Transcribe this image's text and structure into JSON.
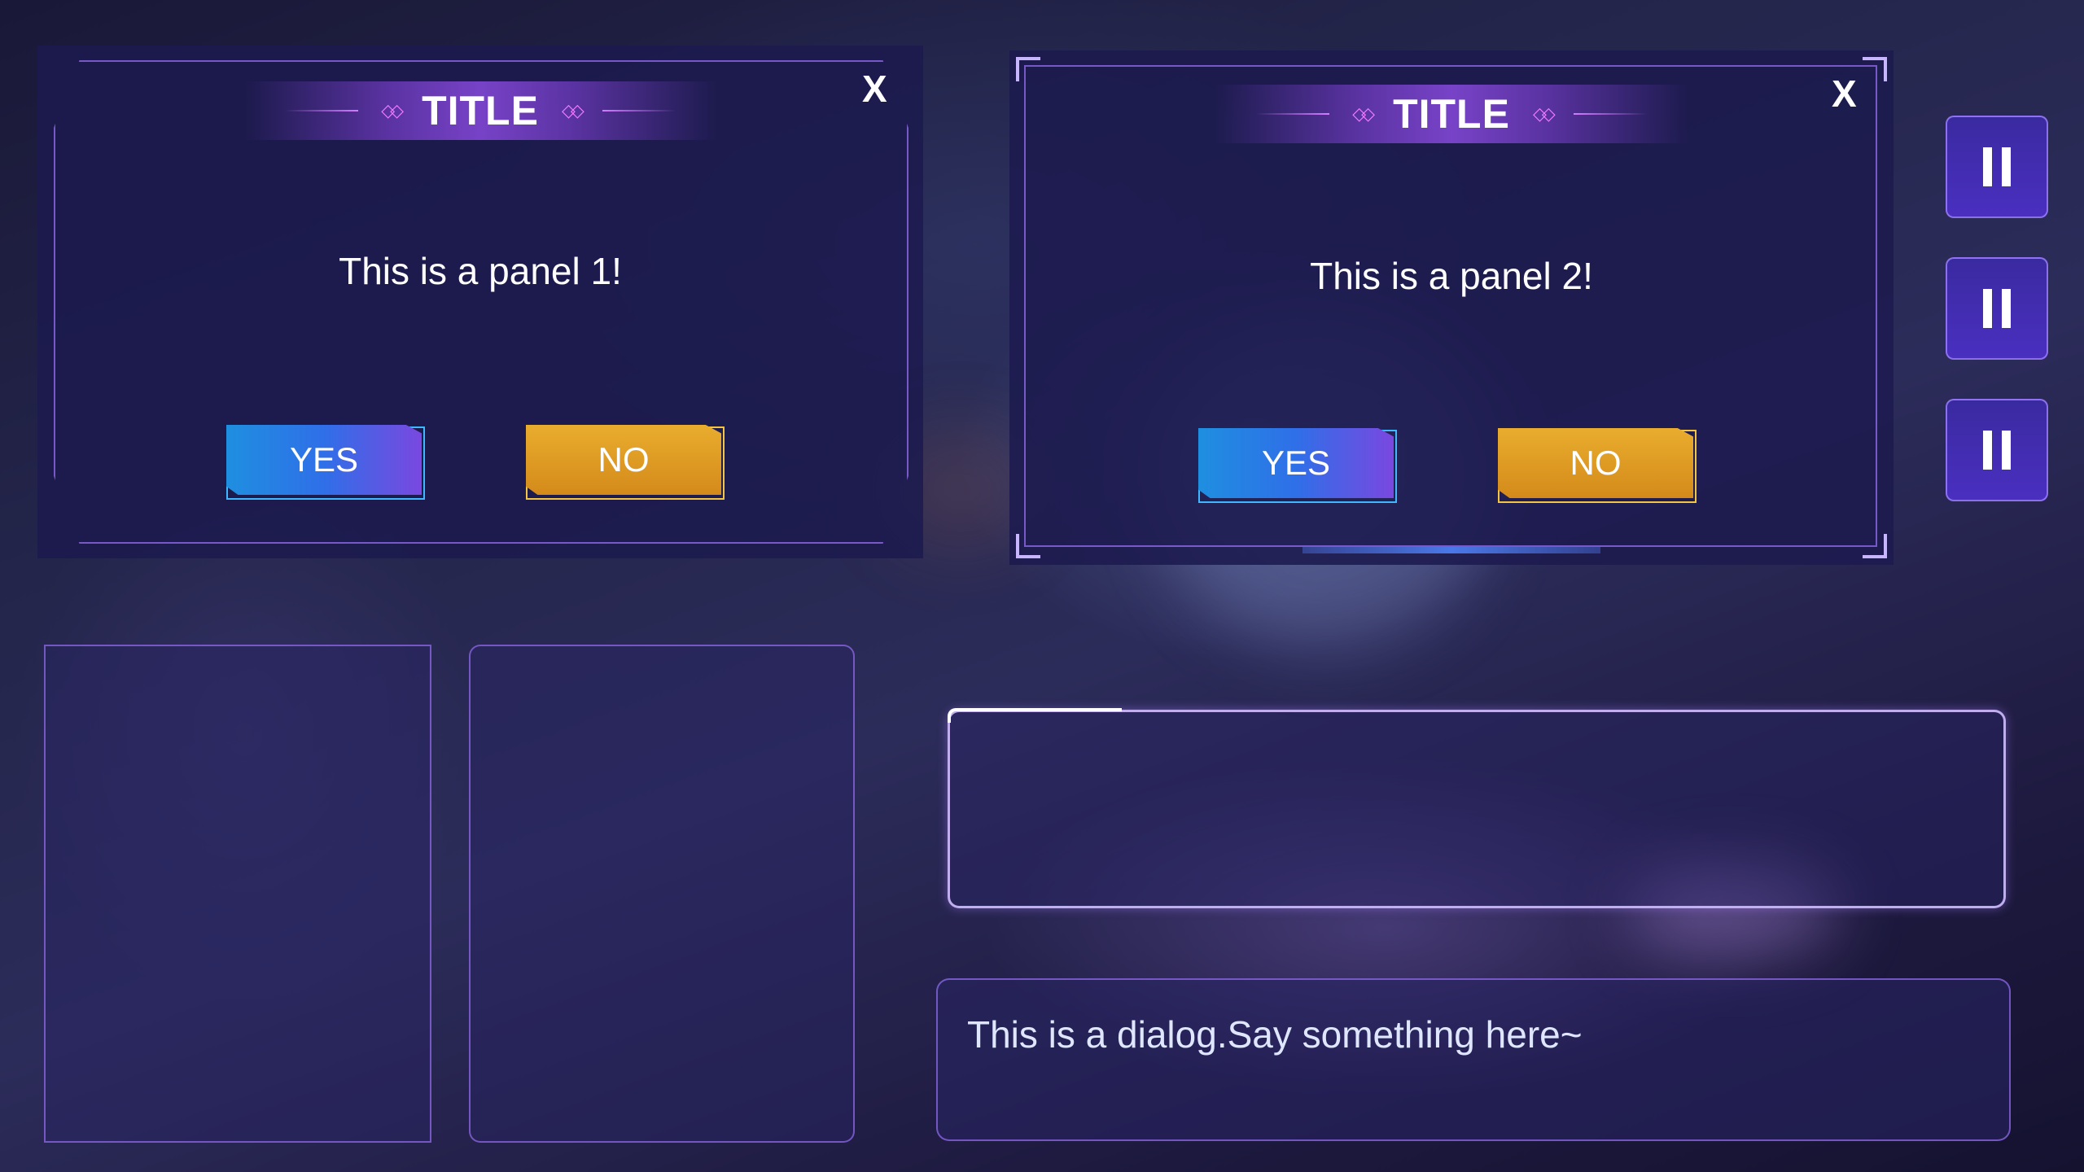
{
  "panel_1": {
    "title": "TITLE",
    "close_label": "X",
    "message": "This is a panel 1!",
    "yes_label": "YES",
    "no_label": "NO"
  },
  "panel_2": {
    "title": "TITLE",
    "close_label": "X",
    "message": "This is a panel 2!",
    "yes_label": "YES",
    "no_label": "NO"
  },
  "decor": {
    "title_diamonds": "◇◇"
  },
  "pause_buttons": [
    {
      "icon": "pause-icon"
    },
    {
      "icon": "pause-icon"
    },
    {
      "icon": "pause-icon"
    }
  ],
  "dialog": {
    "text": "This is a dialog.Say something here~"
  },
  "colors": {
    "accent_purple": "#8a5cf0",
    "yes_blue": "#1f8fe0",
    "no_orange": "#e0a020",
    "panel_bg": "#1c1a4e"
  }
}
